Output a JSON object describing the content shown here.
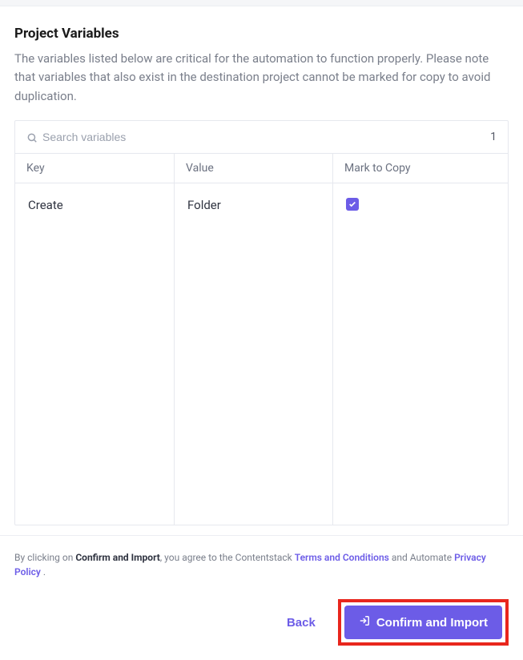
{
  "header": {
    "title": "Project Variables",
    "description": "The variables listed below are critical for the automation to function properly. Please note that variables that also exist in the destination project cannot be marked for copy to avoid duplication."
  },
  "search": {
    "placeholder": "Search variables",
    "count": "1"
  },
  "table": {
    "columns": {
      "key": "Key",
      "value": "Value",
      "mark": "Mark to Copy"
    },
    "rows": [
      {
        "key": "Create",
        "value": "Folder",
        "marked": true
      }
    ]
  },
  "footer": {
    "agree_prefix": "By clicking on ",
    "agree_bold": "Confirm and Import",
    "agree_mid1": ", you agree to the Contentstack ",
    "terms_link": "Terms and Conditions",
    "agree_mid2": " and Automate ",
    "privacy_link": "Privacy Policy",
    "agree_suffix": " .",
    "back_label": "Back",
    "confirm_label": "Confirm and Import"
  }
}
